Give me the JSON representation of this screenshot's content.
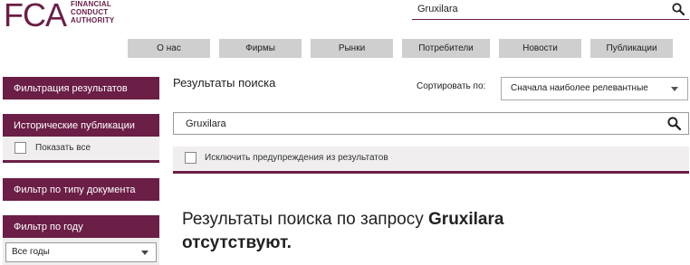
{
  "logo": {
    "letters": "FCA",
    "line1": "FINANCIAL",
    "line2": "CONDUCT",
    "line3": "AUTHORITY"
  },
  "top_search": {
    "value": "Gruxilara",
    "icon": "search-icon"
  },
  "nav": {
    "items": [
      {
        "label": "О нас"
      },
      {
        "label": "Фирмы"
      },
      {
        "label": "Рынки"
      },
      {
        "label": "Потребители"
      },
      {
        "label": "Новости"
      },
      {
        "label": "Публикации"
      }
    ]
  },
  "sidebar": {
    "filter_results": "Фильтрация результатов",
    "historical": "Исторические публикации",
    "show_all": "Показать все",
    "doc_type_filter": "Фильтр по типу документа",
    "year_filter": "Фильтр по году",
    "year_select": "Все годы"
  },
  "main": {
    "title": "Результаты поиска",
    "sort_label": "Сортировать по:",
    "sort_value": "Сначала наиболее релевантные",
    "search_value": "Gruxilara",
    "exclude_label": "Исключить предупреждения из результатов",
    "no_results_prefix": "Результаты поиска по запросу",
    "no_results_query": "Gruxilara",
    "no_results_suffix": "отсутствуют."
  },
  "colors": {
    "brand": "#6b1e46",
    "nav_bg": "#cfcfcf",
    "panel_bg": "#f0eeee"
  }
}
